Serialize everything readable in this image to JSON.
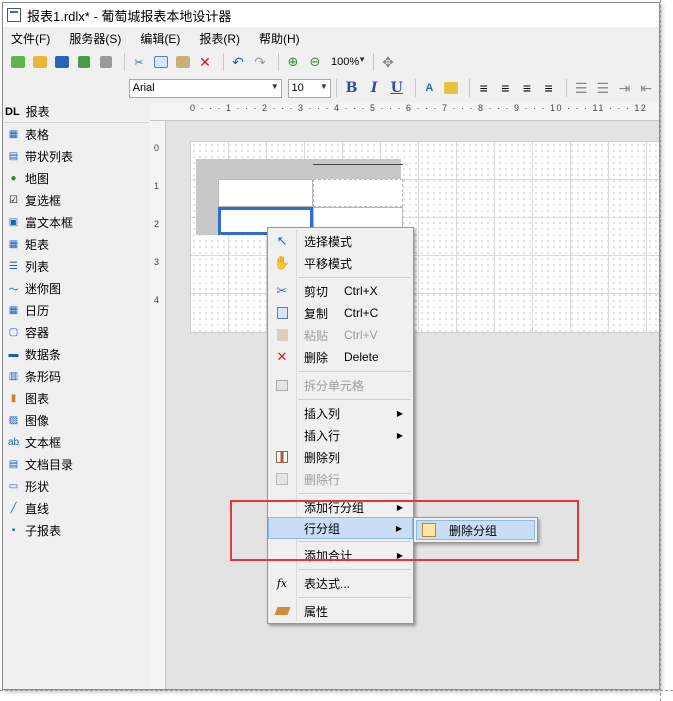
{
  "window": {
    "title": "报表1.rdlx* - 葡萄城报表本地设计器"
  },
  "menu": [
    "文件(F)",
    "服务器(S)",
    "编辑(E)",
    "报表(R)",
    "帮助(H)"
  ],
  "toolbar": {
    "zoom": "100%",
    "font_name": "Arial",
    "font_size": "10",
    "bold": "B",
    "italic": "I",
    "underline": "U"
  },
  "sidebar": {
    "header": {
      "badge": "DL",
      "title": "报表"
    },
    "items": [
      {
        "label": "表格",
        "icon": "table-icon"
      },
      {
        "label": "带状列表",
        "icon": "banded-list-icon"
      },
      {
        "label": "地图",
        "icon": "globe-icon"
      },
      {
        "label": "复选框",
        "icon": "checkbox-icon"
      },
      {
        "label": "富文本框",
        "icon": "rich-textbox-icon"
      },
      {
        "label": "矩表",
        "icon": "matrix-icon"
      },
      {
        "label": "列表",
        "icon": "list-icon"
      },
      {
        "label": "迷你图",
        "icon": "sparkline-icon"
      },
      {
        "label": "日历",
        "icon": "calendar-icon"
      },
      {
        "label": "容器",
        "icon": "container-icon"
      },
      {
        "label": "数据条",
        "icon": "databar-icon"
      },
      {
        "label": "条形码",
        "icon": "barcode-icon"
      },
      {
        "label": "图表",
        "icon": "chart-icon"
      },
      {
        "label": "图像",
        "icon": "image-icon"
      },
      {
        "label": "文本框",
        "icon": "textbox-icon"
      },
      {
        "label": "文档目录",
        "icon": "toc-icon"
      },
      {
        "label": "形状",
        "icon": "shape-icon"
      },
      {
        "label": "直线",
        "icon": "line-icon"
      },
      {
        "label": "子报表",
        "icon": "subreport-icon"
      }
    ]
  },
  "ruler": {
    "top": "0 · · · 1 · · · 2 · · · 3 · · · 4 · · · 5 · · · 6 · · · 7 · · · 8 · · · 9 · · · 10 · · · 11 · · · 12",
    "left": [
      "0",
      "1",
      "2",
      "3",
      "4"
    ]
  },
  "context_menu": {
    "select_mode": "选择模式",
    "pan_mode": "平移模式",
    "cut": "剪切",
    "cut_sc": "Ctrl+X",
    "copy": "复制",
    "copy_sc": "Ctrl+C",
    "paste": "粘贴",
    "paste_sc": "Ctrl+V",
    "delete": "删除",
    "delete_sc": "Delete",
    "split_cells": "拆分单元格",
    "insert_column": "插入列",
    "insert_row": "插入行",
    "delete_column": "删除列",
    "delete_row": "删除行",
    "add_row_group": "添加行分组",
    "row_group": "行分组",
    "add_total": "添加合计",
    "expression": "表达式...",
    "properties": "属性"
  },
  "submenu": {
    "delete_group": "删除分组"
  },
  "colors": {
    "highlight": "#c9def5",
    "annotation_box": "#e3383a",
    "selection": "#2f6dd0"
  }
}
